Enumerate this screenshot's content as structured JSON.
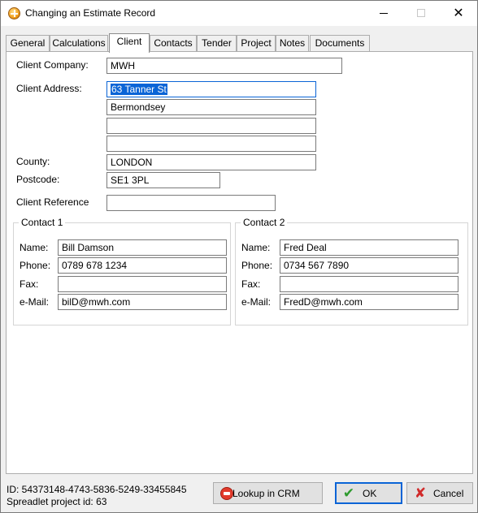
{
  "window": {
    "title": "Changing an Estimate Record"
  },
  "tabs": [
    "General",
    "Calculations",
    "Client",
    "Contacts",
    "Tender",
    "Project",
    "Notes",
    "Documents"
  ],
  "active_tab": "Client",
  "client": {
    "company_label": "Client Company:",
    "company_value": "MWH",
    "address_label": "Client Address:",
    "address_lines": [
      "63 Tanner St",
      "Bermondsey",
      "",
      ""
    ],
    "county_label": "County:",
    "county_value": "LONDON",
    "postcode_label": "Postcode:",
    "postcode_value": "SE1 3PL",
    "reference_label": "Client Reference",
    "reference_value": ""
  },
  "contact_labels": {
    "name": "Name:",
    "phone": "Phone:",
    "fax": "Fax:",
    "email": "e-Mail:"
  },
  "contact1": {
    "title": "Contact 1",
    "name": "Bill Damson",
    "phone": "0789 678 1234",
    "fax": "",
    "email": "bilD@mwh.com"
  },
  "contact2": {
    "title": "Contact 2",
    "name": "Fred Deal",
    "phone": "0734 567 7890",
    "fax": "",
    "email": "FredD@mwh.com"
  },
  "status": {
    "id_text": "ID: 54373148-4743-5836-5249-33455845",
    "project_text": "Spreadlet project id: 63"
  },
  "buttons": {
    "lookup": "Lookup in CRM",
    "ok": "OK",
    "cancel": "Cancel"
  }
}
